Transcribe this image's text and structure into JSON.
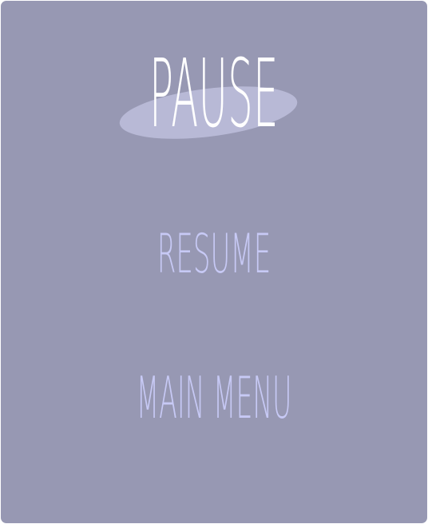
{
  "pause_menu": {
    "title": "PAUSE",
    "items": [
      {
        "label": "RESUME"
      },
      {
        "label": "MAIN MENU"
      }
    ]
  },
  "colors": {
    "background": "#9798b3",
    "title": "#ffffff",
    "title_highlight": "#b8b9d6",
    "menu_text": "#c7c9f5"
  }
}
